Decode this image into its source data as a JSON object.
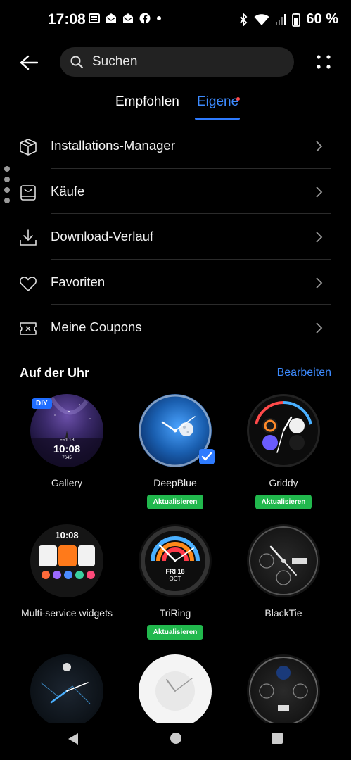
{
  "status_bar": {
    "time": "17:08",
    "battery_percent": "60 %",
    "icons": [
      "news-icon",
      "mail-icon",
      "mail-icon",
      "facebook-icon",
      "dot-icon",
      "bluetooth-icon",
      "wifi-icon",
      "signal-icon",
      "battery-icon"
    ]
  },
  "header": {
    "search_placeholder": "Suchen"
  },
  "tabs": [
    {
      "label": "Empfohlen",
      "active": false
    },
    {
      "label": "Eigene",
      "active": true
    }
  ],
  "menu": [
    {
      "label": "Installations-Manager",
      "icon": "package-icon"
    },
    {
      "label": "Käufe",
      "icon": "bag-icon"
    },
    {
      "label": "Download-Verlauf",
      "icon": "download-icon"
    },
    {
      "label": "Favoriten",
      "icon": "heart-icon"
    },
    {
      "label": "Meine Coupons",
      "icon": "coupon-icon"
    }
  ],
  "section": {
    "title": "Auf der Uhr",
    "action": "Bearbeiten"
  },
  "faces": [
    {
      "name": "Gallery",
      "update": "",
      "badge": "DIY",
      "time": "10:08",
      "date": "FRI 18",
      "steps": "7645"
    },
    {
      "name": "DeepBlue",
      "update": "Aktualisieren",
      "selected": true
    },
    {
      "name": "Griddy",
      "update": "Aktualisieren"
    },
    {
      "name": "Multi-service widgets",
      "update": "",
      "time": "10:08"
    },
    {
      "name": "TriRing",
      "update": "Aktualisieren",
      "date": "FRI 18",
      "month": "OCT"
    },
    {
      "name": "BlackTie",
      "update": ""
    },
    {
      "name": "",
      "update": ""
    },
    {
      "name": "",
      "update": ""
    },
    {
      "name": "",
      "update": ""
    }
  ],
  "colors": {
    "accent": "#2e7bff",
    "update_green": "#21b84d",
    "background": "#000000"
  }
}
